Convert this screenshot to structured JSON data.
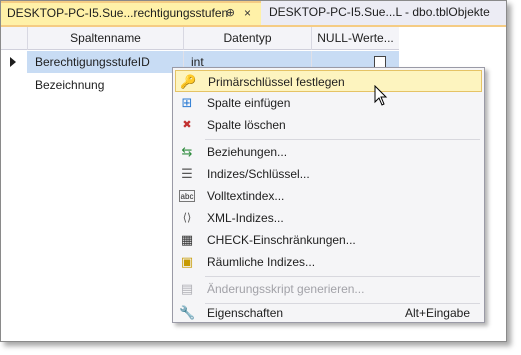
{
  "tabs": {
    "active": {
      "title": "DESKTOP-PC-I5.Sue...rechtigungsstufen",
      "pin": "⊕",
      "close": "×"
    },
    "inactive": {
      "title": "DESKTOP-PC-I5.Sue...L - dbo.tblObjekte"
    }
  },
  "grid": {
    "headers": [
      "Spaltenname",
      "Datentyp",
      "NULL-Werte..."
    ],
    "rows": [
      {
        "name": "BerechtigungsstufeID",
        "type": "int",
        "nullable": false
      },
      {
        "name": "Bezeichnung",
        "type": "",
        "nullable": false
      }
    ]
  },
  "context_menu": {
    "items": [
      {
        "label": "Primärschlüssel festlegen",
        "icon": "key-icon",
        "glyph": "🔑"
      },
      {
        "label": "Spalte einfügen",
        "icon": "insert-column-icon",
        "glyph": "⊞"
      },
      {
        "label": "Spalte löschen",
        "icon": "delete-column-icon",
        "glyph": "✖"
      },
      {
        "label": "Beziehungen...",
        "icon": "relationships-icon",
        "glyph": "⇆"
      },
      {
        "label": "Indizes/Schlüssel...",
        "icon": "indexes-icon",
        "glyph": "☰"
      },
      {
        "label": "Volltextindex...",
        "icon": "fulltext-icon",
        "glyph": "abc"
      },
      {
        "label": "XML-Indizes...",
        "icon": "xml-icon",
        "glyph": "⟨⟩"
      },
      {
        "label": "CHECK-Einschränkungen...",
        "icon": "check-constraints-icon",
        "glyph": "▦"
      },
      {
        "label": "Räumliche Indizes...",
        "icon": "spatial-index-icon",
        "glyph": "▣"
      },
      {
        "label": "Änderungsskript generieren...",
        "icon": "script-icon",
        "glyph": "▤",
        "disabled": true
      },
      {
        "label": "Eigenschaften",
        "icon": "wrench-icon",
        "glyph": "🔧",
        "shortcut": "Alt+Eingabe"
      }
    ]
  },
  "colors": {
    "active_tab": "#fff1a8",
    "selection": "#c8dcf4",
    "menu_hover": "#fdf4bf"
  }
}
